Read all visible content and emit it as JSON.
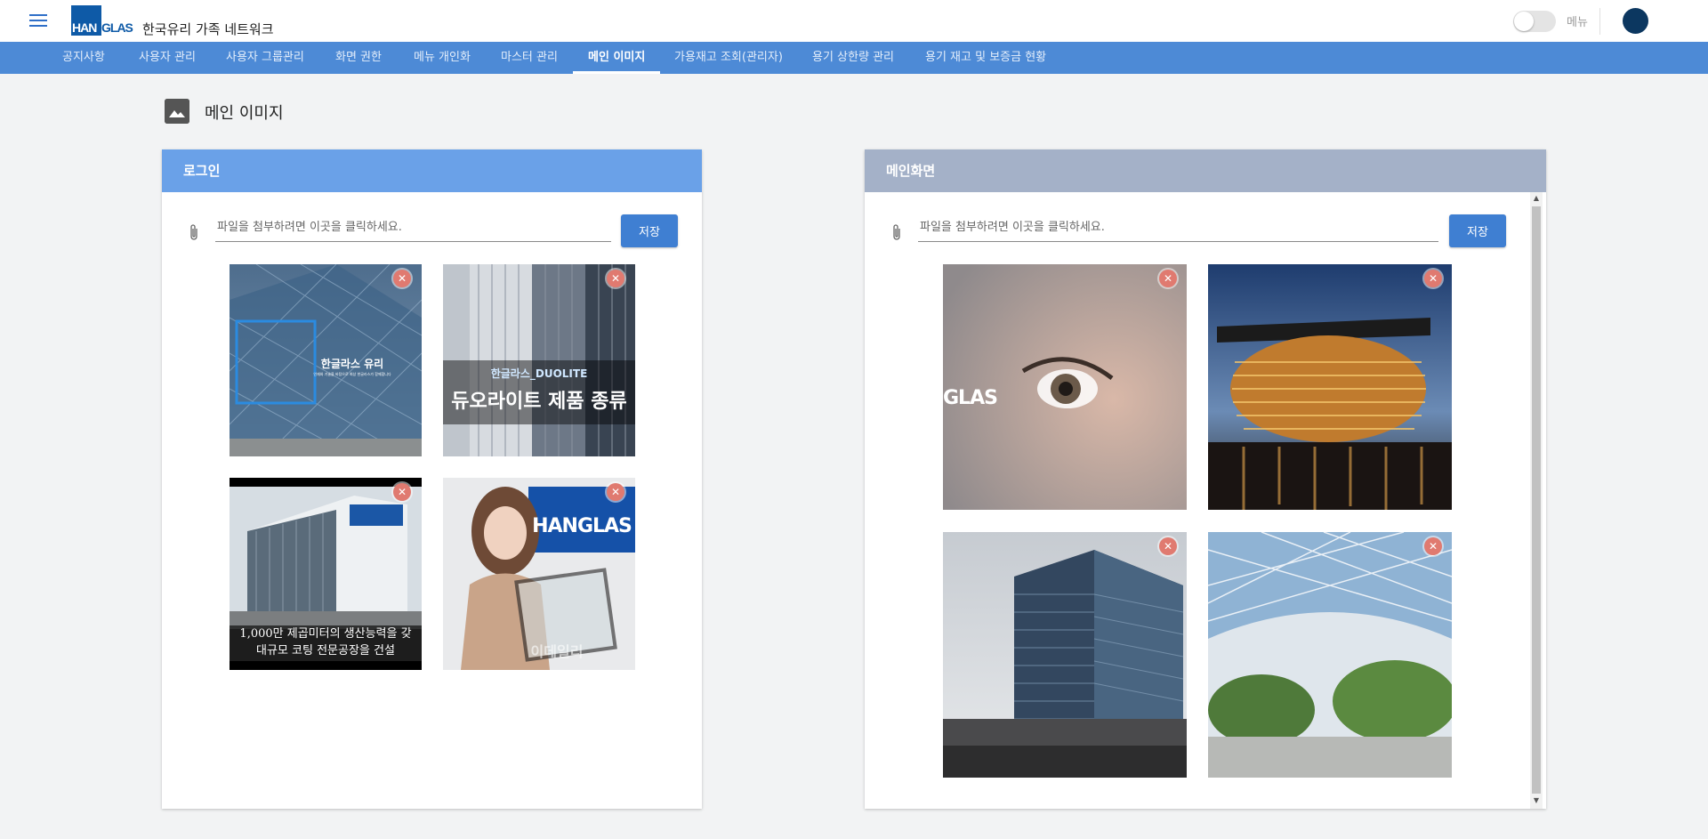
{
  "header": {
    "logo_left": "HAN",
    "logo_right": "GLAS",
    "site_title": "한국유리 가족 네트워크",
    "menu_toggle_label": "메뉴"
  },
  "nav": {
    "items": [
      {
        "label": "공지사항"
      },
      {
        "label": "사용자 관리"
      },
      {
        "label": "사용자 그룹관리"
      },
      {
        "label": "화면 권한"
      },
      {
        "label": "메뉴 개인화"
      },
      {
        "label": "마스터 관리"
      },
      {
        "label": "메인 이미지"
      },
      {
        "label": "가용재고 조회(관리자)"
      },
      {
        "label": "용기 상한량 관리"
      },
      {
        "label": "용기 재고 및 보증금 현황"
      }
    ],
    "active": "메인 이미지"
  },
  "page": {
    "title": "메인 이미지"
  },
  "login_panel": {
    "title": "로그인",
    "file_placeholder": "파일을 첨부하려면 이곳을 클릭하세요.",
    "save_label": "저장",
    "images": [
      {
        "caption": "한글라스 유리",
        "subcaption": "인재와 기술을 바탕으로 최상 한글라스가 함께합니다"
      },
      {
        "caption_top": "한글라스_DUOLITE",
        "caption": "듀오라이트 제품 종류"
      },
      {
        "caption": "1,000만 제곱미터의 생산능력을 갖",
        "caption2": "대규모 코팅 전문공장을 건설"
      },
      {
        "caption": "HANGLAS",
        "watermark": "이데일리"
      }
    ]
  },
  "main_panel": {
    "title": "메인화면",
    "file_placeholder": "파일을 첨부하려면 이곳을 클릭하세요.",
    "save_label": "저장",
    "images": [
      {
        "caption": "GLAS"
      },
      {
        "caption": ""
      },
      {
        "caption": ""
      },
      {
        "caption": ""
      }
    ]
  },
  "icons": {
    "delete": "close-icon",
    "attach": "paperclip-icon",
    "menu": "hamburger-icon",
    "page": "image-icon"
  },
  "colors": {
    "nav": "#4d8ad6",
    "login_header": "#6aa1e8",
    "main_header": "#a4b1c8",
    "button": "#3f7fd2",
    "delete": "#e07a70",
    "logo": "#0e5aa7"
  }
}
